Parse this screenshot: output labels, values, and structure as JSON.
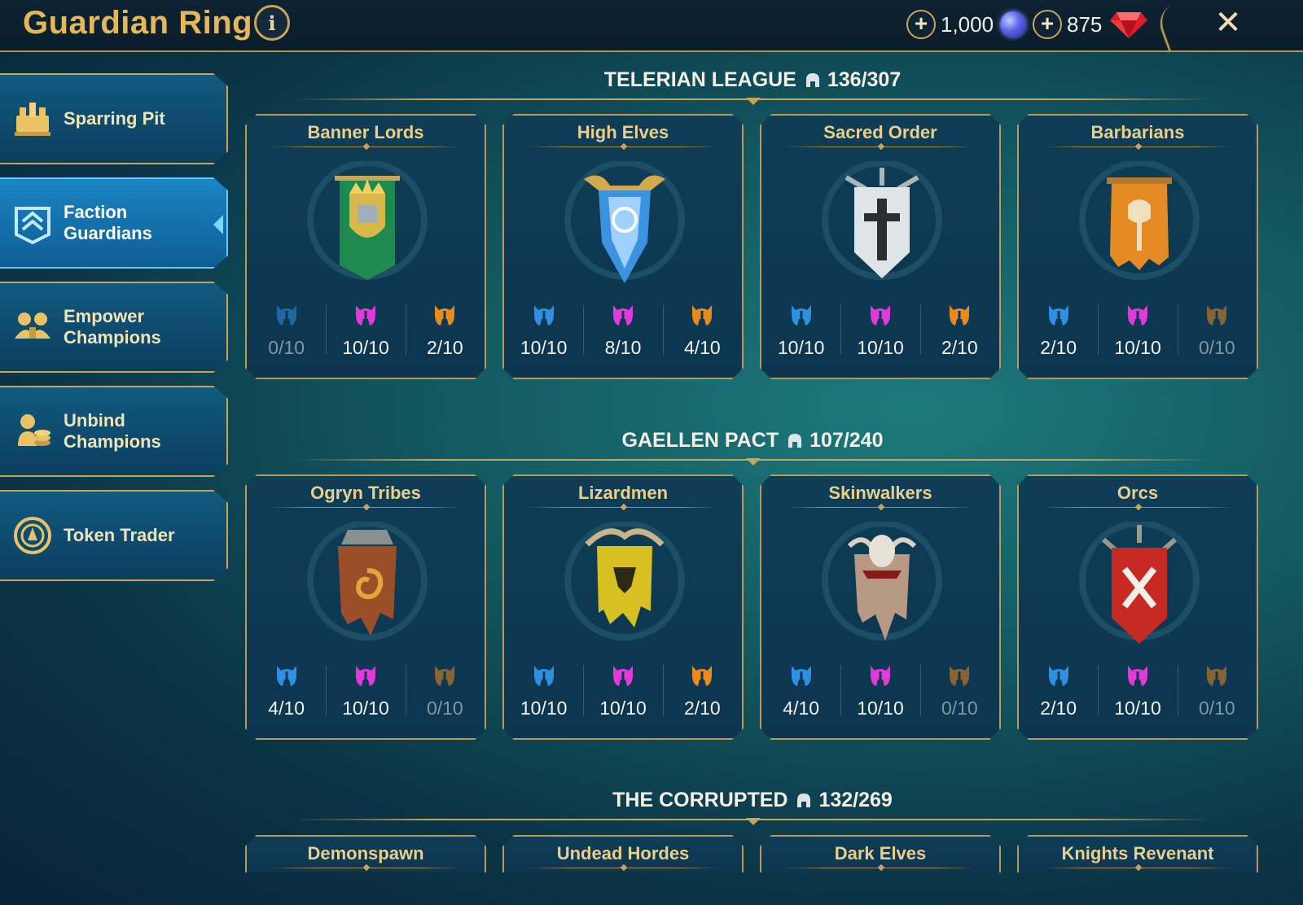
{
  "header": {
    "title": "Guardian Ring",
    "info_icon": "info-icon",
    "currencies": [
      {
        "name": "arena-token",
        "value": "1,000",
        "icon": "token-icon"
      },
      {
        "name": "gems",
        "value": "875",
        "icon": "gem-icon"
      }
    ],
    "close_icon": "close-icon"
  },
  "sidebar": {
    "items": [
      {
        "label": "Sparring Pit",
        "icon": "sparring-pit-icon",
        "active": false
      },
      {
        "label": "Faction Guardians",
        "icon": "faction-guardians-icon",
        "active": true
      },
      {
        "label": "Empower Champions",
        "icon": "empower-champions-icon",
        "active": false
      },
      {
        "label": "Unbind Champions",
        "icon": "unbind-champions-icon",
        "active": false
      },
      {
        "label": "Token Trader",
        "icon": "token-trader-icon",
        "active": false
      }
    ]
  },
  "colors": {
    "rare": "#2f8fe0",
    "epic": "#e03ad8",
    "legendary": "#e88a1e",
    "gold": "#c9a55a"
  },
  "leagues": [
    {
      "name": "TELERIAN LEAGUE",
      "count": "136/307",
      "factions": [
        {
          "name": "Banner Lords",
          "slots": [
            "0/10",
            "10/10",
            "2/10"
          ]
        },
        {
          "name": "High Elves",
          "slots": [
            "10/10",
            "8/10",
            "4/10"
          ]
        },
        {
          "name": "Sacred Order",
          "slots": [
            "10/10",
            "10/10",
            "2/10"
          ]
        },
        {
          "name": "Barbarians",
          "slots": [
            "2/10",
            "10/10",
            "0/10"
          ]
        }
      ]
    },
    {
      "name": "GAELLEN PACT",
      "count": "107/240",
      "factions": [
        {
          "name": "Ogryn Tribes",
          "slots": [
            "4/10",
            "10/10",
            "0/10"
          ]
        },
        {
          "name": "Lizardmen",
          "slots": [
            "10/10",
            "10/10",
            "2/10"
          ]
        },
        {
          "name": "Skinwalkers",
          "slots": [
            "4/10",
            "10/10",
            "0/10"
          ]
        },
        {
          "name": "Orcs",
          "slots": [
            "2/10",
            "10/10",
            "0/10"
          ]
        }
      ]
    },
    {
      "name": "THE CORRUPTED",
      "count": "132/269",
      "factions": [
        {
          "name": "Demonspawn"
        },
        {
          "name": "Undead Hordes"
        },
        {
          "name": "Dark Elves"
        },
        {
          "name": "Knights Revenant"
        }
      ]
    }
  ]
}
